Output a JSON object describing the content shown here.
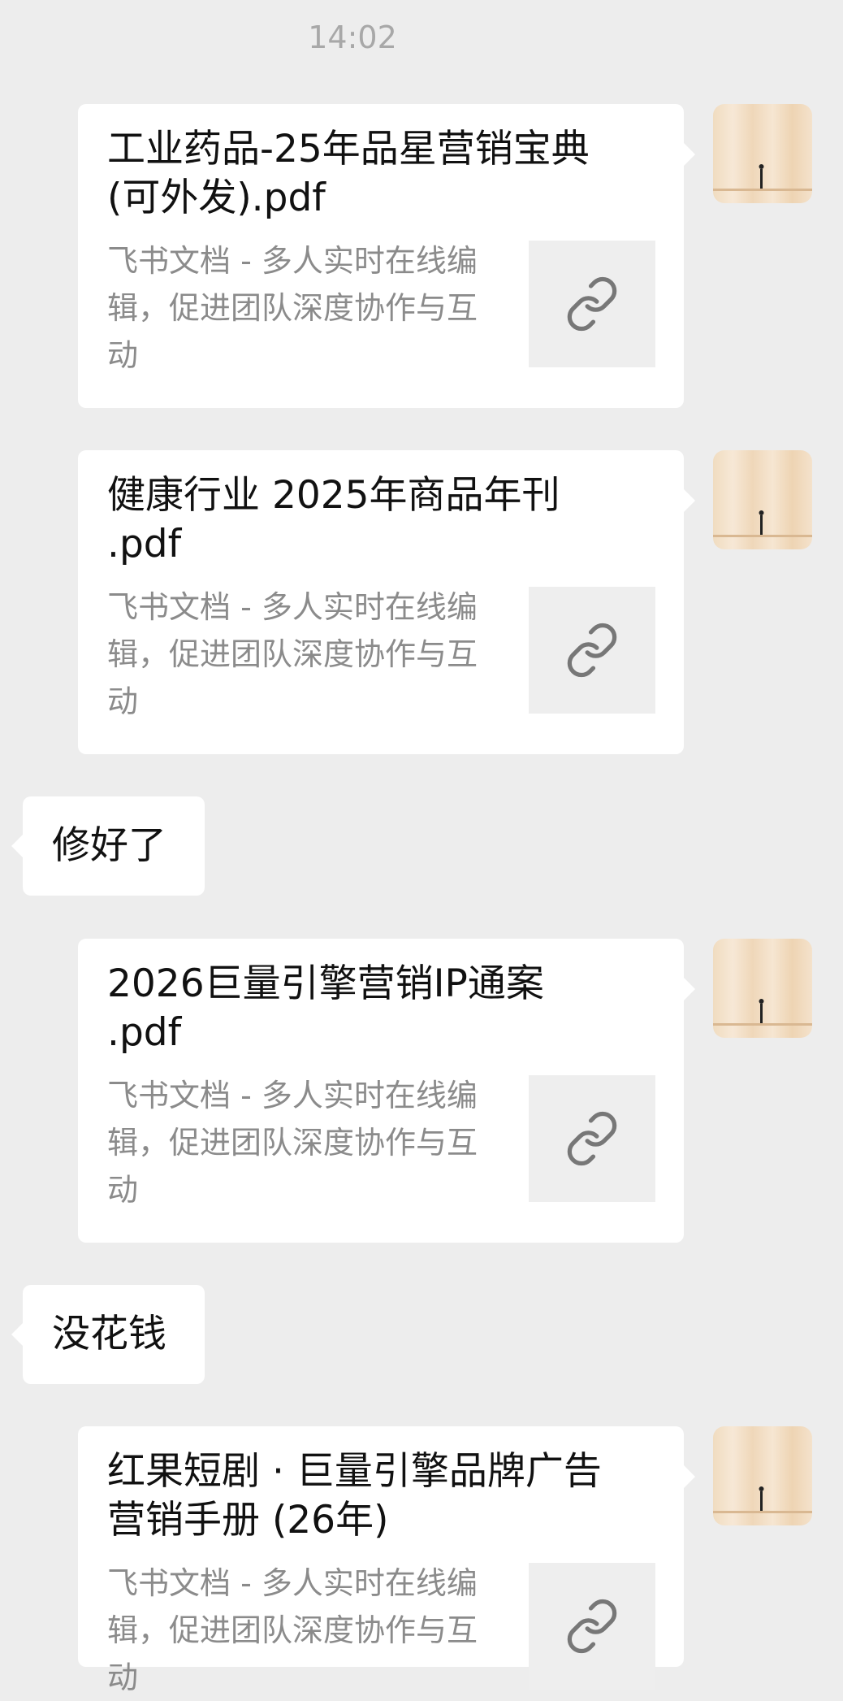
{
  "timestamp": "14:02",
  "messages": [
    {
      "title_line1": "工业药品-25年品星营销宝典",
      "title_line2": "(可外发).pdf",
      "desc": "飞书文档 - 多人实时在线编辑，促进团队深度协作与互动"
    },
    {
      "title_line1": "健康行业 2025年商品年刊",
      "title_line2": ".pdf",
      "desc": "飞书文档 - 多人实时在线编辑，促进团队深度协作与互动"
    },
    {
      "text": "修好了"
    },
    {
      "title_line1": "2026巨量引擎营销IP通案",
      "title_line2": ".pdf",
      "desc": "飞书文档 - 多人实时在线编辑，促进团队深度协作与互动"
    },
    {
      "text": "没花钱"
    },
    {
      "title_line1": "红果短剧 · 巨量引擎品牌广告",
      "title_line2": "营销手册 (26年)",
      "desc": "飞书文档 - 多人实时在线编辑，促进团队深度协作与互动"
    }
  ],
  "icons": {
    "avatar": "avatar-image",
    "link": "link-icon"
  }
}
